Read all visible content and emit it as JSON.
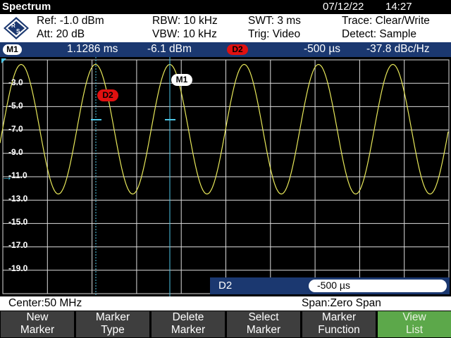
{
  "title": "Spectrum",
  "date": "07/12/22",
  "time": "14:27",
  "settings": {
    "ref": "Ref:  -1.0 dBm",
    "att": "Att:  20 dB",
    "rbw": "RBW:  10 kHz",
    "vbw": "VBW:  10 kHz",
    "swt": "SWT:  3 ms",
    "trig": "Trig:  Video",
    "trace": "Trace:  Clear/Write",
    "detect": "Detect:  Sample"
  },
  "marker_bar": {
    "m1_label": "M1",
    "m1_time": "1.1286  ms",
    "m1_level": "-6.1  dBm",
    "d2_label": "D2",
    "d2_time": "-500  µs",
    "d2_level": "-37.8  dBc/Hz"
  },
  "y_axis_labels": [
    "-3.0",
    "-5.0",
    "-7.0",
    "-9.0",
    "-11.0",
    "-13.0",
    "-15.0",
    "-17.0",
    "-19.0"
  ],
  "plot_markers": {
    "m1": "M1",
    "d2": "D2"
  },
  "entry": {
    "label": "D2",
    "value": "-500 µs"
  },
  "center": "Center:50 MHz",
  "span": "Span:Zero Span",
  "softkeys": [
    {
      "line1": "New",
      "line2": "Marker"
    },
    {
      "line1": "Marker",
      "line2": "Type"
    },
    {
      "line1": "Delete",
      "line2": "Marker"
    },
    {
      "line1": "Select",
      "line2": "Marker"
    },
    {
      "line1": "Marker",
      "line2": "Function"
    },
    {
      "line1": "View",
      "line2": "List"
    }
  ],
  "colors": {
    "trace": "#e8e85a",
    "marker_line": "#4ec8e8",
    "accent": "#1b3870",
    "delta": "#e01010",
    "active_key": "#5ca84a"
  },
  "icons": {
    "logo": "rohde-schwarz-logo",
    "ref_level": "arrow-right-icon"
  }
}
